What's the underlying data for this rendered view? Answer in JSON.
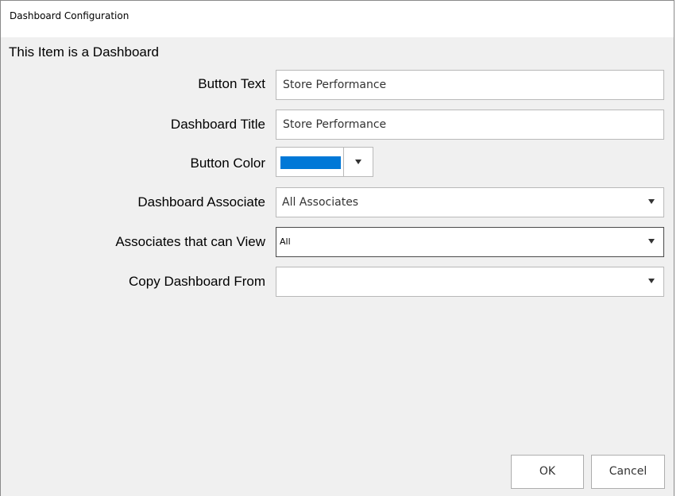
{
  "window": {
    "title": "Dashboard Configuration"
  },
  "section": {
    "header": "This Item is a Dashboard"
  },
  "form": {
    "button_text": {
      "label": "Button Text",
      "value": "Store Performance"
    },
    "dashboard_title": {
      "label": "Dashboard Title",
      "value": "Store Performance"
    },
    "button_color": {
      "label": "Button Color",
      "color": "#0078d7"
    },
    "dashboard_associate": {
      "label": "Dashboard Associate",
      "selected": "All Associates"
    },
    "associates_can_view": {
      "label": "Associates that can View",
      "selected": "All"
    },
    "copy_dashboard_from": {
      "label": "Copy Dashboard From",
      "selected": ""
    }
  },
  "buttons": {
    "ok": "OK",
    "cancel": "Cancel"
  },
  "icons": {
    "dropdown": "chevron-down-icon"
  }
}
